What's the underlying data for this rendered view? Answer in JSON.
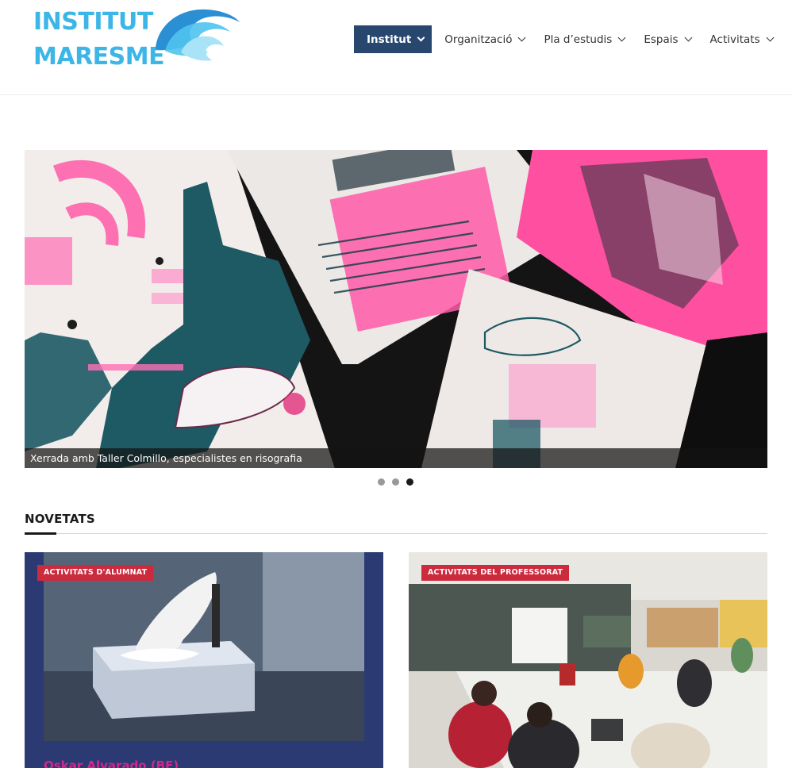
{
  "site": {
    "logo_line1": "INSTITUT",
    "logo_line2": "MARESME",
    "logo_icon": "wave-icon",
    "brand_color": "#3bb6e6"
  },
  "nav": {
    "items": [
      {
        "label": "Institut",
        "active": true
      },
      {
        "label": "Organització",
        "active": false
      },
      {
        "label": "Pla d’estudis",
        "active": false
      },
      {
        "label": "Espais",
        "active": false
      },
      {
        "label": "Activitats",
        "active": false
      }
    ],
    "active_color": "#27476e"
  },
  "slider": {
    "caption": "Xerrada amb Taller Colmillo, especialistes en risografia",
    "slide_count": 3,
    "active_slide": 3
  },
  "news": {
    "heading": "NOVETATS",
    "cards": [
      {
        "badge": "ACTIVITATS D'ALUMNAT",
        "title": "Oskar Alvarado (BE)"
      },
      {
        "badge": "ACTIVITATS DEL PROFESSORAT",
        "title": ""
      }
    ],
    "badge_color": "#cc2b3d"
  }
}
